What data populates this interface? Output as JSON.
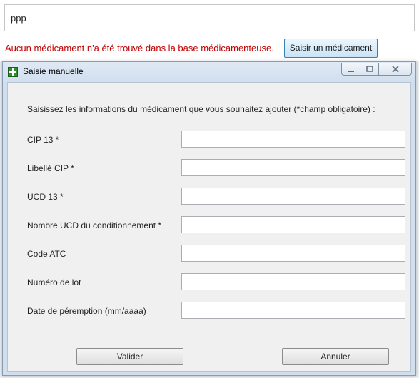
{
  "search": {
    "value": "ppp"
  },
  "status": {
    "error_message": "Aucun médicament n'a été trouvé dans la base médicamenteuse.",
    "enter_button_label": "Saisir un médicament"
  },
  "dialog": {
    "title": "Saisie manuelle",
    "icon": "green-cross-icon",
    "window_buttons": {
      "minimize": "minimize-icon",
      "maximize": "maximize-icon",
      "close": "close-icon"
    },
    "instructions": "Saisissez les informations du médicament que vous souhaitez ajouter (*champ obligatoire) :",
    "fields": [
      {
        "label": "CIP 13 *",
        "value": ""
      },
      {
        "label": "Libellé CIP *",
        "value": ""
      },
      {
        "label": "UCD 13 *",
        "value": ""
      },
      {
        "label": "Nombre UCD du conditionnement *",
        "value": ""
      },
      {
        "label": "Code ATC",
        "value": ""
      },
      {
        "label": "Numéro de lot",
        "value": ""
      },
      {
        "label": "Date de péremption (mm/aaaa)",
        "value": ""
      }
    ],
    "validate_label": "Valider",
    "cancel_label": "Annuler"
  }
}
